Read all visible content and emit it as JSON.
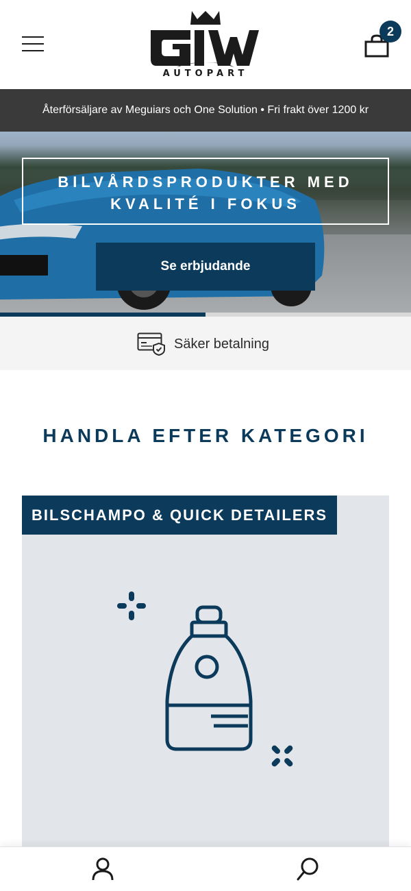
{
  "header": {
    "logo_text": "AUTOPART",
    "cart_count": "2",
    "menu_icon": "hamburger-icon",
    "cart_icon": "shopping-bag-icon"
  },
  "announcement": {
    "text": "Återförsäljare av Meguiars och One Solution • Fri frakt över 1200 kr"
  },
  "hero": {
    "title_line1": "BILVÅRDSPRODUKTER MED",
    "title_line2": "KVALITÉ I FOKUS",
    "button_label": "Se erbjudande",
    "slide_progress": 0.5
  },
  "trust": {
    "label": "Säker betalning",
    "icon": "secure-card-icon"
  },
  "categories": {
    "heading": "HANDLA EFTER KATEGORI",
    "items": [
      {
        "label": "BILSCHAMPO & QUICK DETAILERS",
        "icon": "shampoo-bottle-icon"
      }
    ]
  },
  "bottom_nav": {
    "account_icon": "user-icon",
    "search_icon": "search-icon"
  },
  "colors": {
    "brand": "#0b3a5b",
    "announcement_bg": "#3a3a3a",
    "card_bg": "#e2e6ea"
  }
}
